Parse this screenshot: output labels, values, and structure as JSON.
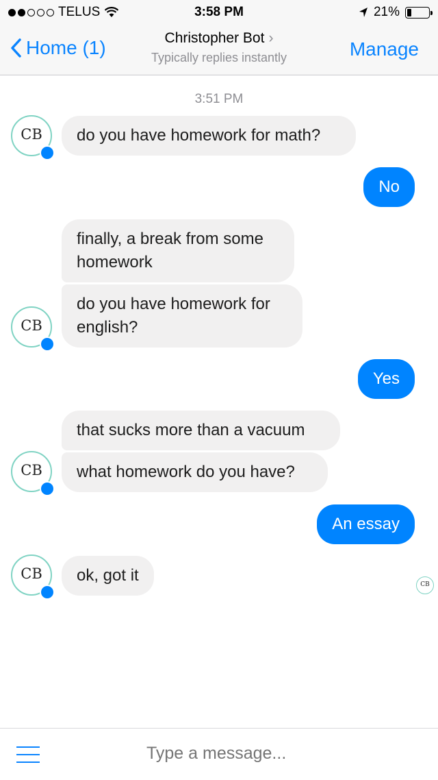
{
  "status_bar": {
    "carrier": "TELUS",
    "time": "3:58 PM",
    "battery": "21%",
    "battery_level": 0.21,
    "signal_icon": "signal-dots-icon",
    "wifi_icon": "wifi-icon",
    "location_icon": "location-arrow-icon"
  },
  "nav": {
    "back_label": "Home (1)",
    "title": "Christopher Bot",
    "subtitle": "Typically replies instantly",
    "manage_label": "Manage"
  },
  "chat": {
    "timestamp": "3:51 PM",
    "avatar_initials": "CB",
    "messages": [
      {
        "from": "bot",
        "text": "do you have homework for math?"
      },
      {
        "from": "user",
        "text": "No"
      },
      {
        "from": "bot",
        "text": "finally, a break from some homework"
      },
      {
        "from": "bot",
        "text": "do you have homework for english?"
      },
      {
        "from": "user",
        "text": "Yes"
      },
      {
        "from": "bot",
        "text": "that sucks more than a vacuum"
      },
      {
        "from": "bot",
        "text": "what homework do you have?"
      },
      {
        "from": "user",
        "text": "An essay"
      },
      {
        "from": "bot",
        "text": "ok, got it"
      }
    ]
  },
  "composer": {
    "placeholder": "Type a message..."
  },
  "colors": {
    "accent": "#0a84ff",
    "outgoing_bubble": "#0084ff",
    "incoming_bubble": "#f1f0f0",
    "avatar_ring": "#7fd3c3"
  }
}
